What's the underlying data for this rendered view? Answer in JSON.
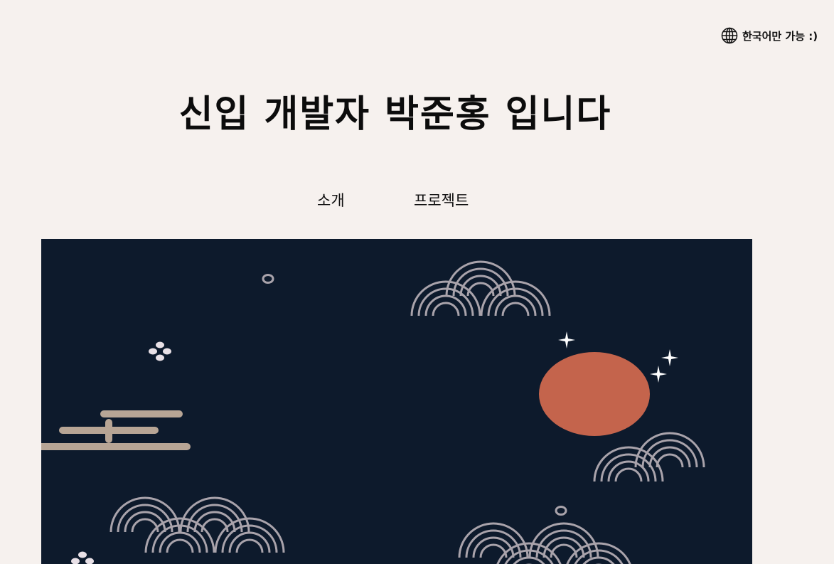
{
  "language": {
    "icon": "globe-icon",
    "label": "한국어만 가능 :)"
  },
  "header": {
    "title": "신입 개발자 박준홍 입니다"
  },
  "nav": {
    "items": [
      {
        "label": "소개"
      },
      {
        "label": "프로젝트"
      }
    ]
  },
  "hero": {
    "description_icon": "korean-night-sky-illustration",
    "colors": {
      "background": "#0d1a2c",
      "sun": "#c4644c",
      "waves": "#a9a3ab",
      "cloud": "#b7a595",
      "stars": "#ffffff"
    }
  }
}
